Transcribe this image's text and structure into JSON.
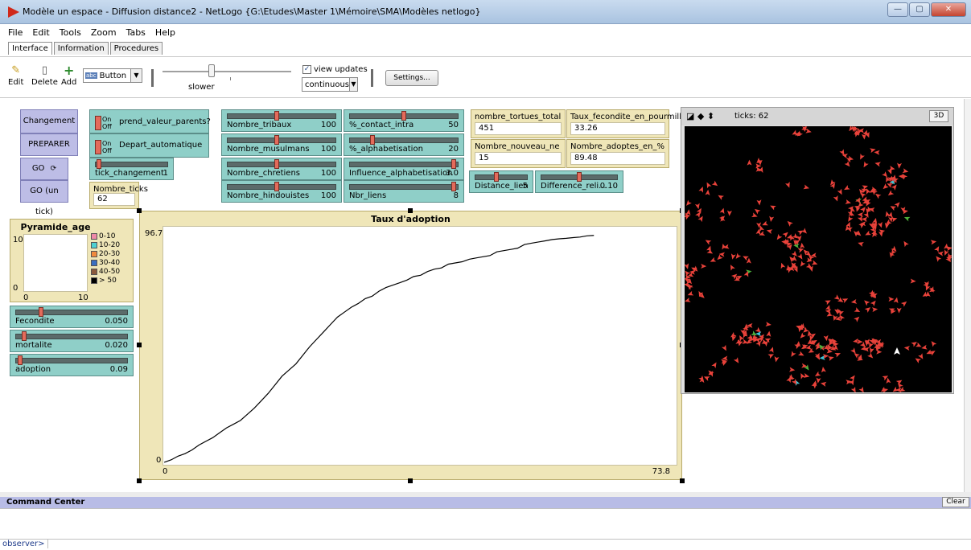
{
  "window": {
    "title": "Modèle un espace - Diffusion distance2 - NetLogo {G:\\Etudes\\Master 1\\Mémoire\\SMA\\Modèles netlogo}",
    "minimize": "—",
    "maximize": "▢",
    "close": "✕"
  },
  "menu": [
    "File",
    "Edit",
    "Tools",
    "Zoom",
    "Tabs",
    "Help"
  ],
  "tabs": [
    "Interface",
    "Information",
    "Procedures"
  ],
  "toolbar": {
    "edit_label": "Edit",
    "delete_label": "Delete",
    "add_label": "Add",
    "widget_type_badge": "abc",
    "widget_type": "Button",
    "speed_label": "slower",
    "view_updates_label": "view updates",
    "view_updates_checked": true,
    "update_mode": "continuous",
    "settings_label": "Settings..."
  },
  "buttons": {
    "changement": "Changement",
    "preparer": "PREPARER",
    "go": "GO",
    "go_forever_icon": "⟳",
    "go_un_tick": "GO (un tick)"
  },
  "switches": [
    {
      "name": "prend_valeur_parents?",
      "on": "On",
      "off": "Off"
    },
    {
      "name": "Depart_automatique",
      "on": "On",
      "off": "Off"
    }
  ],
  "sliders": {
    "tick_changement": {
      "name": "tick_changement",
      "value": "1",
      "fraction": 0.02
    },
    "nombre_tribaux": {
      "name": "Nombre_tribaux",
      "value": "100",
      "fraction": 0.45
    },
    "nombre_musulmans": {
      "name": "Nombre_musulmans",
      "value": "100",
      "fraction": 0.45
    },
    "nombre_chretiens": {
      "name": "Nombre_chretiens",
      "value": "100",
      "fraction": 0.45
    },
    "nombre_hindouistes": {
      "name": "Nombre_hindouistes",
      "value": "100",
      "fraction": 0.45
    },
    "contact_intra": {
      "name": "%_contact_intra",
      "value": "50",
      "fraction": 0.5
    },
    "alphabetisation": {
      "name": "%_alphabetisation",
      "value": "20",
      "fraction": 0.2
    },
    "influence_alphabetisation": {
      "name": "Influence_alphabetisation",
      "value": "3.0",
      "fraction": 0.98
    },
    "nbr_liens": {
      "name": "Nbr_liens",
      "value": "8",
      "fraction": 0.98
    },
    "distance_lien": {
      "name": "Distance_lien",
      "value": "5",
      "fraction": 0.4
    },
    "difference_reli": {
      "name": "Difference_reli...",
      "value": "0.10",
      "fraction": 0.5
    },
    "fecondite": {
      "name": "Fecondite",
      "value": "0.050",
      "fraction": 0.22
    },
    "mortalite": {
      "name": "mortalite",
      "value": "0.020",
      "fraction": 0.06
    },
    "adoption": {
      "name": "adoption",
      "value": "0.09",
      "fraction": 0.02
    }
  },
  "monitors": {
    "nombre_ticks": {
      "name": "Nombre_ticks",
      "value": "62"
    },
    "nombre_tortues_total": {
      "name": "nombre_tortues_total",
      "value": "451"
    },
    "nombre_nouveau_ne": {
      "name": "Nombre_nouveau_ne",
      "value": "15"
    },
    "taux_fecondite": {
      "name": "Taux_fecondite_en_pourmille",
      "value": "33.26"
    },
    "nombre_adoptes": {
      "name": "Nombre_adoptes_en_%",
      "value": "89.48"
    }
  },
  "pyramide": {
    "title": "Pyramide_age",
    "ymax": "10",
    "ymin": "0",
    "xmin": "0",
    "xmax": "10",
    "legend": [
      {
        "label": "0-10",
        "color": "#f08aa8"
      },
      {
        "label": "10-20",
        "color": "#4fd0d2"
      },
      {
        "label": "20-30",
        "color": "#f08a3e"
      },
      {
        "label": "30-40",
        "color": "#3a6fc0"
      },
      {
        "label": "40-50",
        "color": "#8b5a3c"
      },
      {
        "label": "> 50",
        "color": "#000000"
      }
    ]
  },
  "chart_data": {
    "type": "line",
    "title": "Taux d'adoption",
    "xlabel": "",
    "ylabel": "",
    "xlim": [
      0,
      73.8
    ],
    "ylim": [
      0,
      96.7
    ],
    "x_min_label": "0",
    "x_max_label": "73.8",
    "y_min_label": "0",
    "y_max_label": "96.7",
    "series": [
      {
        "color": "#000000",
        "x": [
          0,
          1,
          2,
          3,
          4,
          5,
          6,
          7,
          8,
          9,
          10,
          11,
          12,
          13,
          14,
          15,
          16,
          17,
          18,
          19,
          20,
          21,
          22,
          23,
          24,
          25,
          26,
          27,
          28,
          29,
          30,
          31,
          32,
          33,
          34,
          35,
          36,
          37,
          38,
          39,
          40,
          41,
          42,
          43,
          44,
          45,
          46,
          47,
          48,
          49,
          50,
          51,
          52,
          53,
          54,
          55,
          56,
          57,
          58,
          59,
          60,
          61,
          62
        ],
        "y": [
          1.0,
          2.0,
          3.5,
          4.5,
          6.0,
          8.0,
          9.5,
          11.0,
          13.0,
          15.0,
          16.5,
          18.0,
          20.5,
          23.0,
          26.0,
          29.0,
          32.5,
          36.0,
          38.5,
          41.0,
          44.5,
          48.0,
          51.0,
          54.0,
          57.0,
          60.0,
          62.0,
          64.0,
          65.5,
          67.5,
          68.5,
          70.5,
          72.0,
          73.0,
          74.0,
          75.0,
          76.5,
          77.0,
          78.5,
          79.5,
          80.0,
          81.5,
          82.0,
          82.5,
          83.5,
          84.0,
          84.5,
          85.0,
          86.5,
          87.0,
          87.5,
          88.0,
          89.5,
          90.0,
          90.5,
          91.0,
          91.5,
          91.8,
          92.0,
          92.3,
          92.5,
          93.0,
          93.2
        ]
      }
    ]
  },
  "world": {
    "ticks_label": "ticks: 62",
    "btn_3d": "3D",
    "turtle_colors": {
      "red": "#e8423a",
      "green": "#4caf3b",
      "cyan": "#3ac6d6",
      "white": "#ffffff"
    }
  },
  "command_center": {
    "title": "Command Center",
    "clear_label": "Clear",
    "observer_label": "observer>"
  }
}
